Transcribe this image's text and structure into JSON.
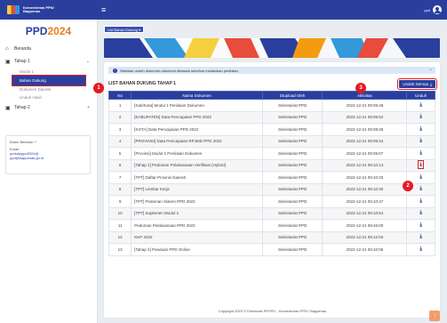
{
  "header": {
    "brand_line1": "Kementerian PPN/",
    "brand_line2": "Bappenas",
    "user_label": "ppd"
  },
  "sidebar": {
    "title_main": "PPD",
    "title_year": "2024",
    "items": [
      {
        "label": "Beranda"
      },
      {
        "label": "Tahap 1"
      },
      {
        "label": "Tahap 2"
      }
    ],
    "subitems_tahap1": [
      {
        "label": "Modul 1"
      },
      {
        "label": "Bahan Dukung"
      },
      {
        "label": "Dokumen Daerah"
      },
      {
        "label": "Unduh Hasil"
      }
    ],
    "help": {
      "title": "Butuh Bantuan ?",
      "email_label": "Email:",
      "email1": "pedulipppd2024@",
      "email2": "ppd@bappenas.go.id"
    }
  },
  "main": {
    "breadcrumb": "List Bahan Dukung",
    "alert_text": "Silahkan unduh dokumen-dokumen dibawah sebelum melakukan penilaian.",
    "list_title": "LIST BAHAN DUKUNG TAHAP 1",
    "download_all_label": "Unduh Semua",
    "columns": [
      "No",
      "Nama Dokumen",
      "Diupload Oleh",
      "Aktivitas",
      "Unduh"
    ],
    "rows": [
      {
        "no": "1",
        "name": "[Kab/Kota] Modul 1 Penilaian Dokumen",
        "by": "Sekretariat PPD",
        "time": "2022-12-21 09:09:48"
      },
      {
        "no": "2",
        "name": "[KABUPATEN] Data Pencapaian PPD 2022",
        "by": "Sekretariat PPD",
        "time": "2022-12-21 09:09:52"
      },
      {
        "no": "3",
        "name": "[KOTA] Data Pencapaian PPD 2022",
        "by": "Sekretariat PPD",
        "time": "2022-12-21 09:09:26"
      },
      {
        "no": "4",
        "name": "[PROVINSI] Data Pencapaian RPJMD PPD 2022",
        "by": "Sekretariat PPD",
        "time": "2022-12-21 09:09:44"
      },
      {
        "no": "5",
        "name": "[Provinsi] Modul 1 Penilaian Dokumen",
        "by": "Sekretariat PPD",
        "time": "2022-12-21 09:09:07"
      },
      {
        "no": "6",
        "name": "[Tahap 2] Pedoman Pelaksanaan Verifikasi (Hybrid)",
        "by": "Sekretariat PPD",
        "time": "2022-12-21 09:10:14"
      },
      {
        "no": "7",
        "name": "[TPT] Daftar Provinsi Daerah",
        "by": "Sekretariat PPD",
        "time": "2022-12-21 09:10:20"
      },
      {
        "no": "8",
        "name": "[TPT] Lembar Kerja",
        "by": "Sekretariat PPD",
        "time": "2022-12-21 09:10:30"
      },
      {
        "no": "9",
        "name": "[TPT] Pedoman Sistem PPD 2022",
        "by": "Sekretariat PPD",
        "time": "2022-12-21 09:10:47"
      },
      {
        "no": "10",
        "name": "[TPT] Suplemen Modul 1",
        "by": "Sekretariat PPD",
        "time": "2022-12-21 09:10:54"
      },
      {
        "no": "11",
        "name": "Pedoman Pelaksanaan PPD 2022",
        "by": "Sekretariat PPD",
        "time": "2022-12-21 09:46:00"
      },
      {
        "no": "12",
        "name": "KKP 2022",
        "by": "Sekretariat PPD",
        "time": "2022-12-21 09:12:03"
      },
      {
        "no": "13",
        "name": "[Tahap 2] Panduan PPD Online",
        "by": "Sekretariat PPD",
        "time": "2022-12-21 09:10:06"
      }
    ],
    "footer": "Copyright 2023 © Direktorat PEPPD - Kementerian PPN / Bappenas"
  },
  "markers": [
    "1",
    "2",
    "3"
  ],
  "colors": {
    "primary": "#2a3f9d",
    "accent": "#e31b23",
    "year": "#e67e22"
  }
}
